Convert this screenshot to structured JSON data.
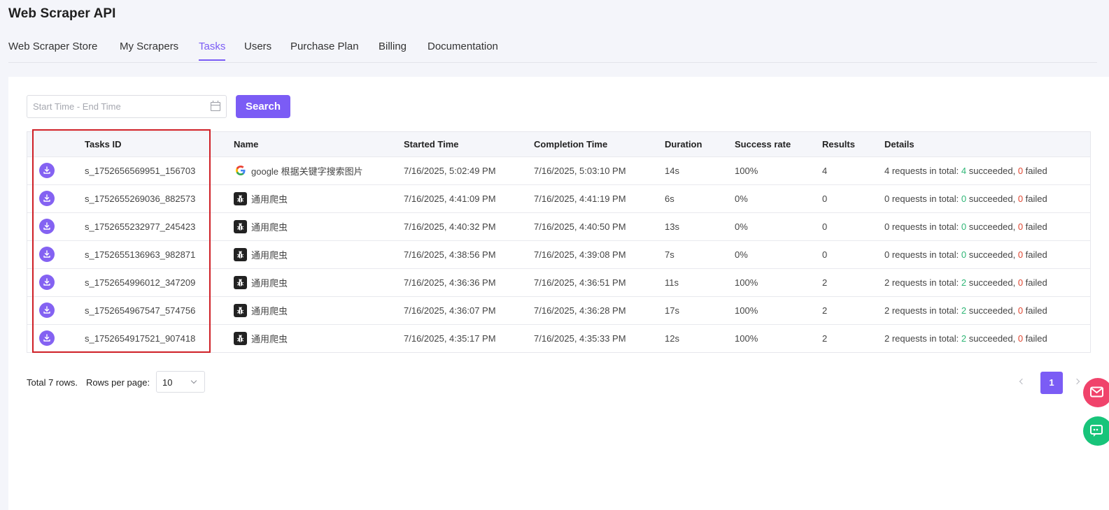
{
  "app": {
    "title": "Web Scraper API"
  },
  "nav": {
    "tabs": [
      {
        "label": "Web Scraper Store"
      },
      {
        "label": "My Scrapers"
      },
      {
        "label": "Tasks",
        "active": true
      },
      {
        "label": "Users"
      },
      {
        "label": "Purchase Plan"
      },
      {
        "label": "Billing"
      },
      {
        "label": "Documentation"
      }
    ]
  },
  "filter": {
    "date_placeholder": "Start Time - End Time",
    "date_icon": "calendar-icon",
    "search_label": "Search"
  },
  "table": {
    "columns": [
      "",
      "Tasks ID",
      "Name",
      "Started Time",
      "Completion Time",
      "Duration",
      "Success rate",
      "Results",
      "Details"
    ],
    "row_action_icon": "download-icon",
    "rows": [
      {
        "id": "s_1752656569951_156703",
        "name_icon": "google-icon",
        "name": "google 根据关键字搜索图片",
        "started": "7/16/2025, 5:02:49 PM",
        "completed": "7/16/2025, 5:03:10 PM",
        "duration": "14s",
        "rate": "100%",
        "results": "4",
        "details_total": "4",
        "details_succeeded": "4",
        "details_failed": "0"
      },
      {
        "id": "s_1752655269036_882573",
        "name_icon": "bug-icon",
        "name": "通用爬虫",
        "started": "7/16/2025, 4:41:09 PM",
        "completed": "7/16/2025, 4:41:19 PM",
        "duration": "6s",
        "rate": "0%",
        "results": "0",
        "details_total": "0",
        "details_succeeded": "0",
        "details_failed": "0"
      },
      {
        "id": "s_1752655232977_245423",
        "name_icon": "bug-icon",
        "name": "通用爬虫",
        "started": "7/16/2025, 4:40:32 PM",
        "completed": "7/16/2025, 4:40:50 PM",
        "duration": "13s",
        "rate": "0%",
        "results": "0",
        "details_total": "0",
        "details_succeeded": "0",
        "details_failed": "0"
      },
      {
        "id": "s_1752655136963_982871",
        "name_icon": "bug-icon",
        "name": "通用爬虫",
        "started": "7/16/2025, 4:38:56 PM",
        "completed": "7/16/2025, 4:39:08 PM",
        "duration": "7s",
        "rate": "0%",
        "results": "0",
        "details_total": "0",
        "details_succeeded": "0",
        "details_failed": "0"
      },
      {
        "id": "s_1752654996012_347209",
        "name_icon": "bug-icon",
        "name": "通用爬虫",
        "started": "7/16/2025, 4:36:36 PM",
        "completed": "7/16/2025, 4:36:51 PM",
        "duration": "11s",
        "rate": "100%",
        "results": "2",
        "details_total": "2",
        "details_succeeded": "2",
        "details_failed": "0"
      },
      {
        "id": "s_1752654967547_574756",
        "name_icon": "bug-icon",
        "name": "通用爬虫",
        "started": "7/16/2025, 4:36:07 PM",
        "completed": "7/16/2025, 4:36:28 PM",
        "duration": "17s",
        "rate": "100%",
        "results": "2",
        "details_total": "2",
        "details_succeeded": "2",
        "details_failed": "0"
      },
      {
        "id": "s_1752654917521_907418",
        "name_icon": "bug-icon",
        "name": "通用爬虫",
        "started": "7/16/2025, 4:35:17 PM",
        "completed": "7/16/2025, 4:35:33 PM",
        "duration": "12s",
        "rate": "100%",
        "results": "2",
        "details_total": "2",
        "details_succeeded": "2",
        "details_failed": "0"
      }
    ],
    "details_template": {
      "prefix": " requests in total: ",
      "succeeded": " succeeded, ",
      "failed": " failed"
    }
  },
  "pager": {
    "total_text": "Total 7 rows.",
    "rows_per_page_label": "Rows per page:",
    "rows_per_page_value": "10",
    "current_page": "1"
  },
  "colors": {
    "accent": "#7b5cf5",
    "success": "#2fb676",
    "failure": "#e0452f",
    "highlight": "#cf1f26",
    "mail_button": "#f0436b",
    "chat_button": "#18c47a"
  },
  "floating": {
    "icons": [
      "mail-icon",
      "chat-icon"
    ]
  }
}
